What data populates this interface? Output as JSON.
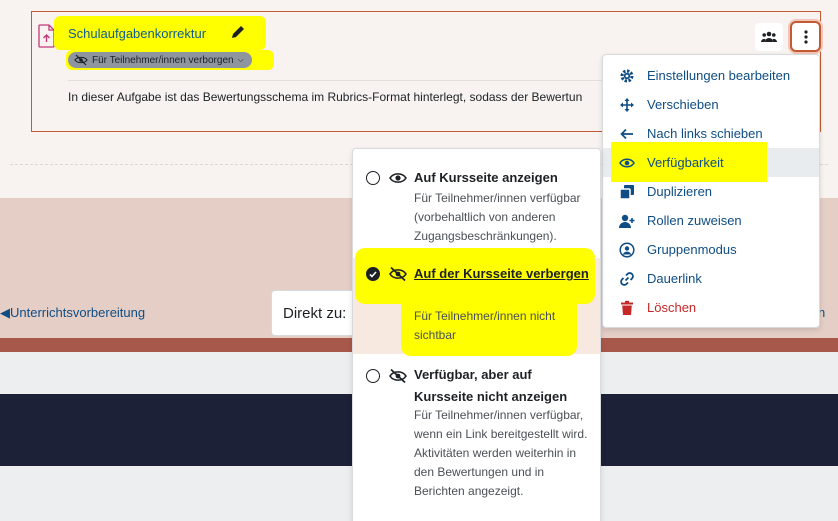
{
  "activity": {
    "title": "Schulaufgabenkorrektur",
    "visibility_badge": "Für Teilnehmer/innen verborgen",
    "description": "In dieser Aufgabe ist das Bewertungsschema im Rubrics-Format hinterlegt, sodass der Bewertun"
  },
  "action_menu": {
    "items": [
      {
        "label": "Einstellungen bearbeiten",
        "icon": "gear-icon"
      },
      {
        "label": "Verschieben",
        "icon": "move-icon"
      },
      {
        "label": "Nach links schieben",
        "icon": "arrow-left-icon"
      },
      {
        "label": "Verfügbarkeit",
        "icon": "eye-icon"
      },
      {
        "label": "Duplizieren",
        "icon": "copy-icon"
      },
      {
        "label": "Rollen zuweisen",
        "icon": "user-plus-icon"
      },
      {
        "label": "Gruppenmodus",
        "icon": "user-circle-icon"
      },
      {
        "label": "Dauerlink",
        "icon": "link-icon"
      },
      {
        "label": "Löschen",
        "icon": "trash-icon"
      }
    ]
  },
  "visibility_menu": {
    "options": [
      {
        "title": "Auf Kursseite anzeigen",
        "desc": "Für Teilnehmer/innen verfügbar (vorbehaltlich von anderen Zugangsbeschränkungen).",
        "checked": false
      },
      {
        "title": "Auf der Kursseite verbergen",
        "desc": "Für Teilnehmer/innen nicht sichtbar",
        "checked": true
      },
      {
        "title": "Verfügbar, aber auf Kursseite nicht anzeigen",
        "desc": "Für Teilnehmer/innen verfügbar, wenn ein Link bereitgestellt wird. Aktivitäten werden weiterhin in den Bewertungen und in Berichten angezeigt.",
        "checked": false
      }
    ]
  },
  "navigation": {
    "prev_label": "◀Unterrichtsvorbereitung",
    "next_label_partial": "n",
    "jump_label": "Direkt zu:"
  },
  "colors": {
    "accent": "#c45a33",
    "link": "#0f4d84",
    "highlight": "#ffff00",
    "danger": "#c62828"
  }
}
